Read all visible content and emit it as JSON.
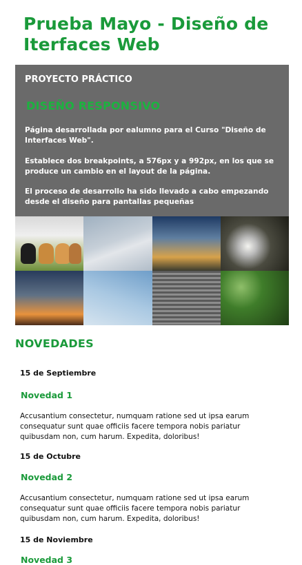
{
  "page": {
    "title": "Prueba Mayo - Diseño de Iterfaces Web"
  },
  "hero": {
    "kicker": "PROYECTO PRÁCTICO",
    "subtitle": "DISEÑO RESPONSIVO",
    "paragraphs": [
      "Página desarrollada por ealumno para el Curso \"Diseño de Interfaces Web\".",
      "Establece dos breakpoints, a 576px y a 992px, en los que se produce un cambio en el layout de la página.",
      "El proceso de desarrollo ha sido llevado a cabo empezando desde el diseño para pantallas pequeñas"
    ],
    "colors": {
      "background": "#6a6a6a",
      "accent": "#1bb33f"
    }
  },
  "gallery": {
    "images": [
      "kittens-photo",
      "cloudy-sky-photo",
      "dusk-sky-photo",
      "tree-sunlight-photo",
      "sunset-horizon-photo",
      "blue-sky-contrails-photo",
      "stone-stairs-photo",
      "green-foliage-photo"
    ]
  },
  "news": {
    "section_title": "NOVEDADES",
    "items": [
      {
        "date": "15 de Septiembre",
        "title": "Novedad 1",
        "body": "Accusantium consectetur, numquam ratione sed ut ipsa earum consequatur sunt quae officiis facere tempora nobis pariatur quibusdam non, cum harum. Expedita, doloribus!"
      },
      {
        "date": "15 de Octubre",
        "title": "Novedad 2",
        "body": "Accusantium consectetur, numquam ratione sed ut ipsa earum consequatur sunt quae officiis facere tempora nobis pariatur quibusdam non, cum harum. Expedita, doloribus!"
      },
      {
        "date": "15 de Noviembre",
        "title": "Novedad 3"
      }
    ]
  },
  "theme": {
    "brand_green": "#1a9a3a"
  }
}
